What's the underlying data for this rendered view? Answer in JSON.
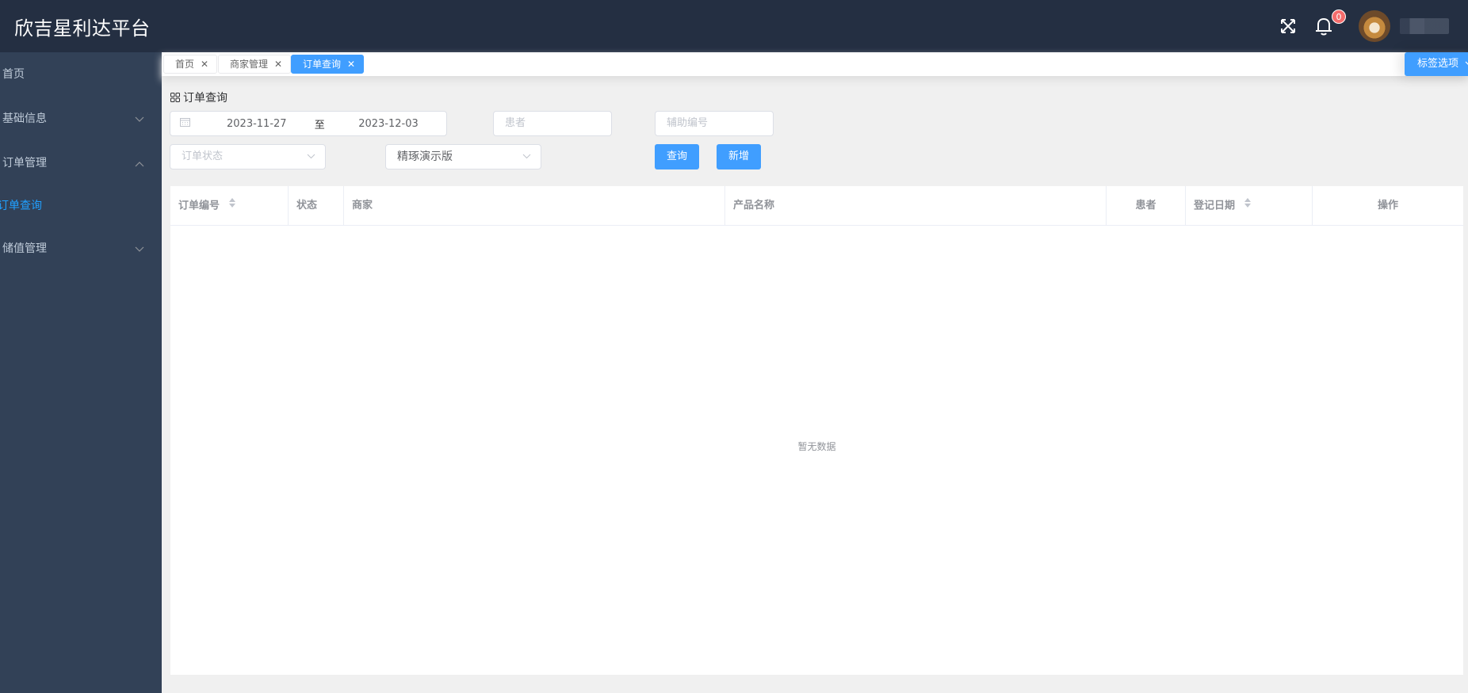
{
  "header": {
    "title": "欣吉星利达平台",
    "notification_count": "0",
    "icons": [
      "fullscreen-icon",
      "bell-icon"
    ],
    "user": {
      "avatar": "dog-avatar",
      "name_blurred": true
    }
  },
  "sidebar": {
    "items": [
      {
        "label": "首页",
        "expandable": false
      },
      {
        "label": "基础信息",
        "expandable": true,
        "expanded": false
      },
      {
        "label": "订单管理",
        "expandable": true,
        "expanded": true,
        "children": [
          {
            "label": "订单查询",
            "active": true
          }
        ]
      },
      {
        "label": "储值管理",
        "expandable": true,
        "expanded": false
      }
    ]
  },
  "tags": {
    "items": [
      {
        "label": "首页",
        "active": false
      },
      {
        "label": "商家管理",
        "active": false
      },
      {
        "label": "订单查询",
        "active": true
      }
    ],
    "options_label": "标签选项"
  },
  "page": {
    "breadcrumb": "订单查询",
    "filters": {
      "date_start": "2023-11-27",
      "date_separator": "至",
      "date_end": "2023-12-03",
      "patient_placeholder": "患者",
      "aux_number_placeholder": "辅助编号",
      "order_status_placeholder": "订单状态",
      "version_selected": "精琢演示版"
    },
    "buttons": {
      "search": "查询",
      "add": "新增"
    },
    "table": {
      "columns": [
        "订单编号",
        "状态",
        "商家",
        "产品名称",
        "患者",
        "登记日期",
        "操作"
      ],
      "sortable": [
        "订单编号",
        "登记日期"
      ],
      "rows": [],
      "empty_text": "暂无数据"
    }
  },
  "colors": {
    "header_bg": "#242f42",
    "sidebar_bg": "#324157",
    "primary": "#409eff",
    "active_menu": "#20a0ff",
    "badge": "#f56c6c"
  }
}
